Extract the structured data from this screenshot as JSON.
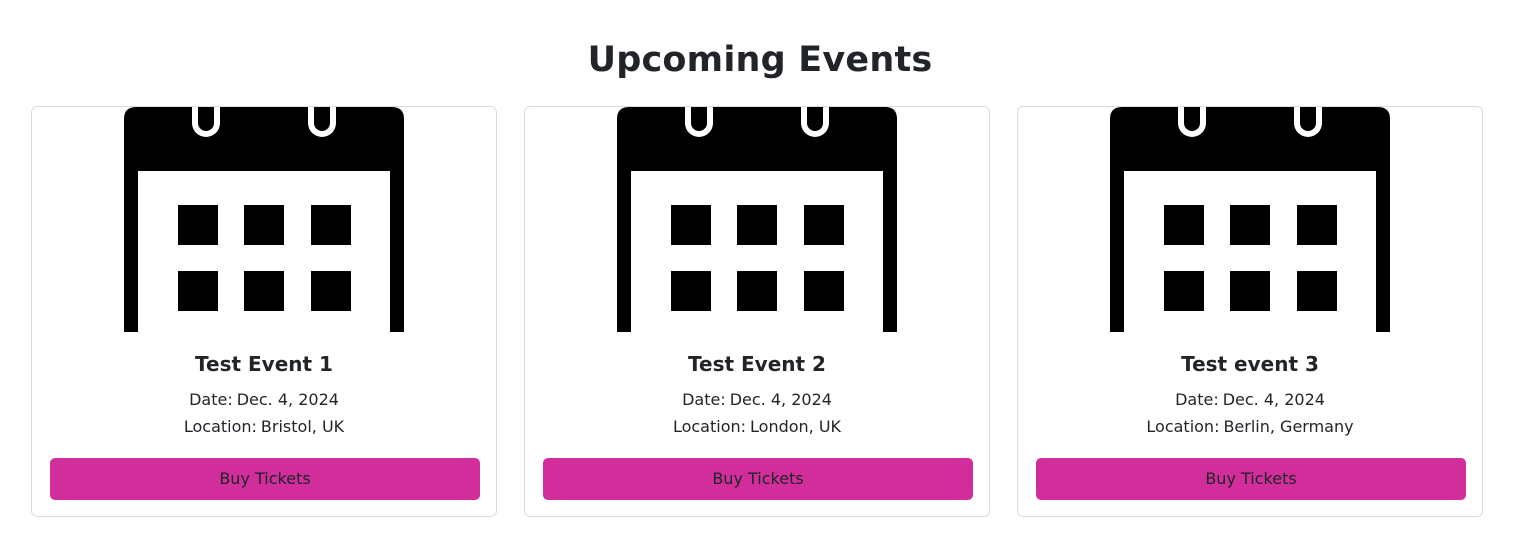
{
  "page": {
    "title": "Upcoming Events"
  },
  "theme": {
    "button_color": "#d12d9b",
    "text_color": "#212529",
    "card_border": "#dcdcdc"
  },
  "events": [
    {
      "icon": "calendar-icon",
      "title": "Test Event 1",
      "date_label": "Date:",
      "date": "Dec. 4, 2024",
      "location_label": "Location:",
      "location": "Bristol, UK",
      "button_label": "Buy Tickets"
    },
    {
      "icon": "calendar-icon",
      "title": "Test Event 2",
      "date_label": "Date:",
      "date": "Dec. 4, 2024",
      "location_label": "Location:",
      "location": "London, UK",
      "button_label": "Buy Tickets"
    },
    {
      "icon": "calendar-icon",
      "title": "Test event 3",
      "date_label": "Date:",
      "date": "Dec. 4, 2024",
      "location_label": "Location:",
      "location": "Berlin, Germany",
      "button_label": "Buy Tickets"
    }
  ]
}
